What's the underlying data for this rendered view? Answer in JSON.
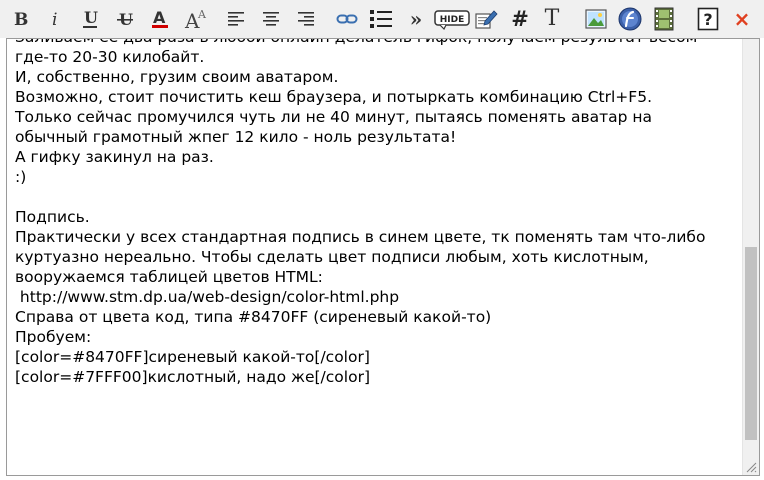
{
  "toolbar": {
    "hide_label": "HIDE",
    "hash_label": "#",
    "text_label": "T",
    "more_label": "»",
    "close_label": "×",
    "help_label": "?"
  },
  "editor": {
    "lines": [
      "Заливаем её два раза в любой онлайн делатель гифок, получаем результат весом",
      "где-то 20-30 килобайт.",
      "И, собственно, грузим своим аватаром.",
      "Возможно, стоит почистить кеш браузера, и потыркать комбинацию Ctrl+F5.",
      "Только сейчас промучился чуть ли не 40 минут, пытаясь поменять аватар на",
      "обычный грамотный жпег 12 кило - ноль результата!",
      "А гифку закинул на раз.",
      ":)",
      "",
      "Подпись.",
      "Практически у всех стандартная подпись в синем цвете, тк поменять там что-либо",
      "куртуазно нереально. Чтобы сделать цвет подписи любым, хоть кислотным,",
      "вооружаемся таблицей цветов HTML:",
      " http://www.stm.dp.ua/web-design/color-html.php",
      "Справа от цвета код, типа #8470FF (сиреневый какой-то)",
      "Пробуем:",
      "[color=#8470FF]сиреневый какой-то[/color]",
      "[color=#7FFF00]кислотный, надо же[/color]"
    ]
  },
  "colors": {
    "font_color_bar": "#d00000",
    "close_red": "#e04020",
    "link_blue": "#3a6fb0"
  }
}
